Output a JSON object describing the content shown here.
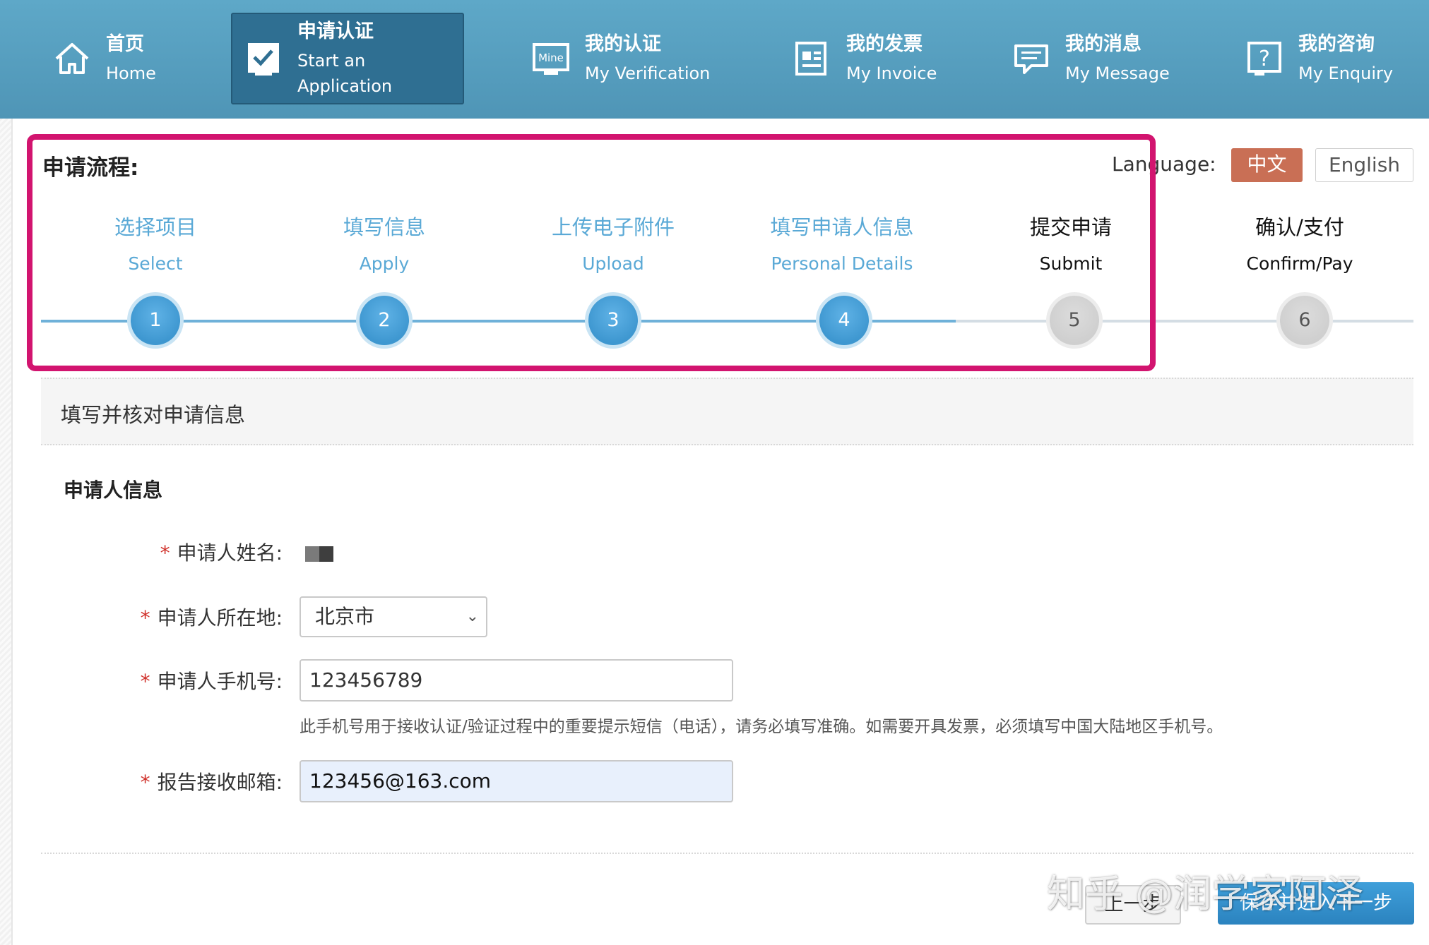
{
  "nav": {
    "items": [
      {
        "zh": "首页",
        "en": "Home",
        "icon": "home-icon"
      },
      {
        "zh": "申请认证",
        "en": "Start an Application",
        "icon": "application-check-icon",
        "active": true
      },
      {
        "zh": "我的认证",
        "en": "My Verification",
        "icon": "mine-verification-icon",
        "icon_text": "Mine"
      },
      {
        "zh": "我的发票",
        "en": "My Invoice",
        "icon": "invoice-icon"
      },
      {
        "zh": "我的消息",
        "en": "My Message",
        "icon": "message-icon"
      },
      {
        "zh": "我的咨询",
        "en": "My Enquiry",
        "icon": "enquiry-icon",
        "icon_text": "?"
      }
    ]
  },
  "process": {
    "title": "申请流程:",
    "language_label": "Language:",
    "languages": [
      "中文",
      "English"
    ],
    "current_step": 4,
    "steps": [
      {
        "zh": "选择项目",
        "en": "Select",
        "num": "1"
      },
      {
        "zh": "填写信息",
        "en": "Apply",
        "num": "2"
      },
      {
        "zh": "上传电子附件",
        "en": "Upload",
        "num": "3"
      },
      {
        "zh": "填写申请人信息",
        "en": "Personal Details",
        "num": "4"
      },
      {
        "zh": "提交申请",
        "en": "Submit",
        "num": "5"
      },
      {
        "zh": "确认/支付",
        "en": "Confirm/Pay",
        "num": "6"
      }
    ]
  },
  "section": {
    "title": "填写并核对申请信息",
    "subhead": "申请人信息"
  },
  "form": {
    "name": {
      "label": "申请人姓名:"
    },
    "location": {
      "label": "申请人所在地:",
      "value": "北京市"
    },
    "phone": {
      "label": "申请人手机号:",
      "value": "123456789",
      "help": "此手机号用于接收认证/验证过程中的重要提示短信（电话），请务必填写准确。如需要开具发票，必须填写中国大陆地区手机号。"
    },
    "email": {
      "label": "报告接收邮箱:",
      "value": "123456@163.com"
    },
    "required_mark": "*"
  },
  "buttons": {
    "prev": "上一步",
    "next": "保存并进入下一步"
  },
  "watermark": "知乎 @润学家阿泽",
  "colors": {
    "nav_bg": "#5ea8c8",
    "nav_active": "#2f6f92",
    "step_done": "#5aa9d6",
    "lang_active": "#c96f55",
    "highlight": "#d2146f",
    "primary_button": "#2b83bf"
  }
}
